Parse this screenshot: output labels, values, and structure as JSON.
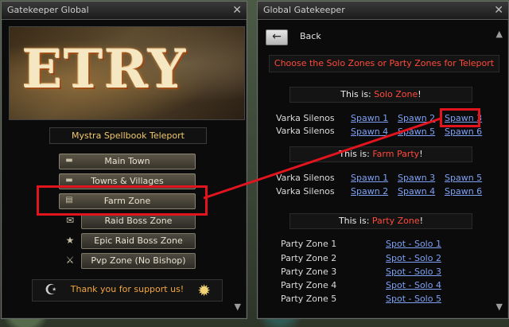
{
  "left_window": {
    "title": "Gatekeeper Global",
    "banner_text": "ETRY",
    "section_label": "Mystra Spellbook Teleport",
    "menu": [
      {
        "label": "Main Town",
        "icon": "flag-icon"
      },
      {
        "label": "Towns & Villages",
        "icon": "flag-icon"
      },
      {
        "label": "Farm Zone",
        "icon": "book-icon"
      },
      {
        "label": "Raid Boss Zone",
        "icon": "scroll-icon"
      },
      {
        "label": "Epic Raid Boss Zone",
        "icon": "star-icon"
      },
      {
        "label": "Pvp Zone (No Bishop)",
        "icon": "crossed-swords-icon"
      }
    ],
    "support_text": "Thank you for support us!"
  },
  "right_window": {
    "title": "Global Gatekeeper",
    "back_label": "Back",
    "choose_text": "Choose the Solo Zones or Party Zones for Teleport",
    "solo_header": {
      "prefix": "This is: ",
      "name": "Solo Zone",
      "suffix": "!"
    },
    "solo_rows": [
      {
        "label": "Varka Silenos",
        "links": [
          "Spawn 1",
          "Spawn 2",
          "Spawn 3"
        ]
      },
      {
        "label": "Varka Silenos",
        "links": [
          "Spawn 4",
          "Spawn 5",
          "Spawn 6"
        ]
      }
    ],
    "farm_header": {
      "prefix": "This is: ",
      "name": "Farm Party",
      "suffix": "!"
    },
    "farm_rows": [
      {
        "label": "Varka Silenos",
        "links": [
          "Spawn 1",
          "Spawn 3",
          "Spawn 5"
        ]
      },
      {
        "label": "Varka Silenos",
        "links": [
          "Spawn 2",
          "Spawn 4",
          "Spawn 6"
        ]
      }
    ],
    "party_header": {
      "prefix": "This is: ",
      "name": "Party Zone",
      "suffix": "!"
    },
    "party_rows": [
      {
        "label": "Party Zone 1",
        "link": "Spot - Solo 1"
      },
      {
        "label": "Party Zone 2",
        "link": "Spot - Solo 2"
      },
      {
        "label": "Party Zone 3",
        "link": "Spot - Solo 3"
      },
      {
        "label": "Party Zone 4",
        "link": "Spot - Solo 4"
      },
      {
        "label": "Party Zone 5",
        "link": "Spot - Solo 5"
      }
    ]
  },
  "colors": {
    "highlight": "#e2141e",
    "accent_red": "#ff4a3a",
    "link": "#7ea1f4",
    "gold": "#f0c96a"
  }
}
